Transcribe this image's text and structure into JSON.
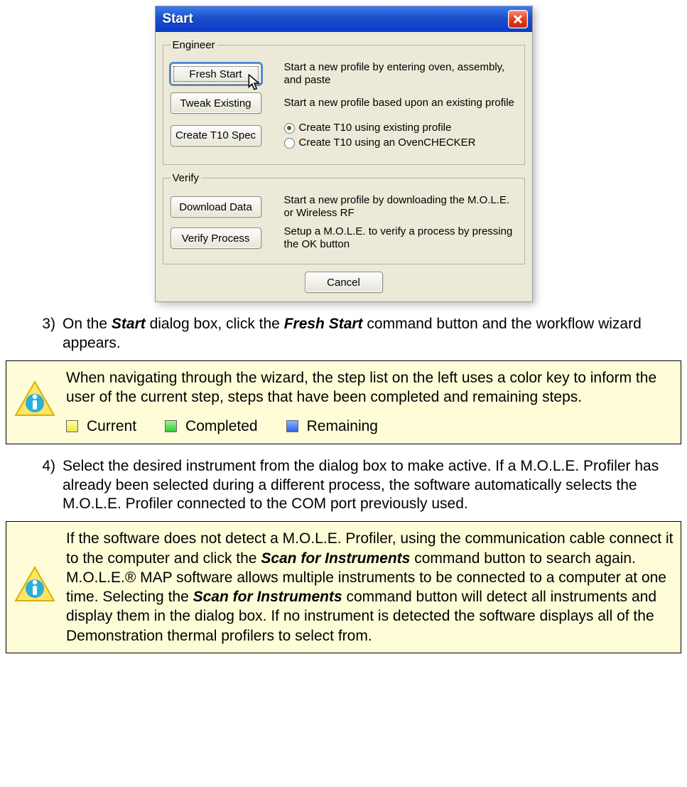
{
  "dialog": {
    "title": "Start",
    "groups": {
      "engineer": {
        "legend": "Engineer",
        "fresh_start": {
          "label": "Fresh Start",
          "desc": "Start a new profile by entering oven, assembly, and paste"
        },
        "tweak": {
          "label": "Tweak Existing",
          "desc": "Start a new profile based upon an existing profile"
        },
        "t10": {
          "label": "Create T10 Spec",
          "opt1": "Create T10 using existing profile",
          "opt2": "Create T10 using an OvenCHECKER"
        }
      },
      "verify": {
        "legend": "Verify",
        "download": {
          "label": "Download Data",
          "desc": "Start a new profile by downloading the M.O.L.E. or Wireless RF"
        },
        "verify_proc": {
          "label": "Verify Process",
          "desc": "Setup a M.O.L.E. to verify a process by pressing the OK button"
        }
      }
    },
    "cancel": "Cancel"
  },
  "step3": {
    "num": "3)",
    "before": "On the ",
    "b1": "Start",
    "mid": " dialog box, click the ",
    "b2": "Fresh Start",
    "after": " command button and the workflow wizard appears."
  },
  "note1": {
    "text": "When navigating through the wizard, the step list on the left uses a color key to inform the user of the current step, steps that have been completed and remaining steps.",
    "legend": {
      "current": "Current",
      "completed": "Completed",
      "remaining": "Remaining"
    }
  },
  "step4": {
    "num": "4)",
    "text": "Select the desired instrument from the dialog box to make active. If a M.O.L.E. Profiler has already been selected during a different process, the software automatically selects the M.O.L.E. Profiler connected to the COM port previously used."
  },
  "note2": {
    "p1": "If the software does not detect a M.O.L.E. Profiler, using the communication cable connect it to the computer and click the ",
    "b1": "Scan for Instruments",
    "p2": " command button to search again. M.O.L.E.® MAP software allows multiple instruments to be connected to a computer at one time. Selecting the ",
    "b2": "Scan for Instruments",
    "p3": " command button will detect all instruments and display them in the dialog box. If no instrument is detected the software displays all of the Demonstration thermal profilers to select from."
  }
}
